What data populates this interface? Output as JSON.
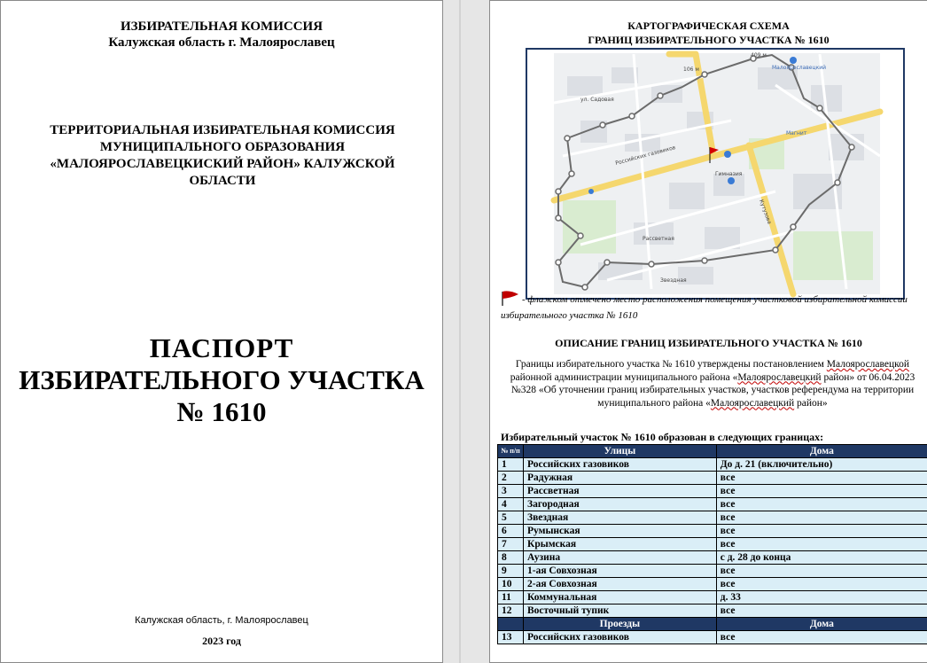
{
  "left_page": {
    "commission_line1": "ИЗБИРАТЕЛЬНАЯ КОМИССИЯ",
    "commission_line2": "Калужская область г. Малоярославец",
    "territorial_line1": "ТЕРРИТОРИАЛЬНАЯ ИЗБИРАТЕЛЬНАЯ КОМИССИЯ",
    "territorial_line2": "МУНИЦИПАЛЬНОГО ОБРАЗОВАНИЯ",
    "territorial_line3": "«МАЛОЯРОСЛАВЕЦКИСКИЙ РАЙОН» КАЛУЖСКОЙ",
    "territorial_line4": "ОБЛАСТИ",
    "passport_line1": "ПАСПОРТ",
    "passport_line2": "ИЗБИРАТЕЛЬНОГО УЧАСТКА",
    "passport_line3": "№ 1610",
    "footer_city": "Калужская область, г. Малоярославец",
    "footer_year": "2023 год"
  },
  "right_page": {
    "map_title_line1": "КАРТОГРАФИЧЕСКАЯ СХЕМА",
    "map_title_line2": "ГРАНИЦ ИЗБИРАТЕЛЬНОГО УЧАСТКА № 1610",
    "map_labels": {
      "dist1": "409 м",
      "dist2": "106 м",
      "poi1": "Малоярославецкий",
      "poi2": "Гимназия",
      "poi3": "Магнит",
      "street1": "ул. Садовая",
      "street2": "Российских газовиков",
      "street3": "Рассветная",
      "street4": "Звездная",
      "street5": "Кутузова"
    },
    "flag_note": "- флажком отмечено место расположения помещения участковой избирательной комиссии избирательного участка № 1610",
    "description_title": "ОПИСАНИЕ ГРАНИЦ ИЗБИРАТЕЛЬНОГО УЧАСТКА № 1610",
    "desc_part1": "Границы избирательного участка № 1610 утверждены постановлением ",
    "desc_word1": "Малоярославецкой",
    "desc_part2": " районной администрации муниципального района «",
    "desc_word2": "Малоярославецкий",
    "desc_part3": " район» от 06.04.2023 №328 «Об уточнении границ избирательных участков, участков референдума на территории муниципального района «",
    "desc_word3": "Малоярославецкий",
    "desc_part4": " район»",
    "table_intro": "Избирательный участок № 1610 образован в следующих границах:",
    "table_headers": {
      "num": "№ п/п",
      "streets": "Улицы",
      "houses": "Дома"
    },
    "rows": [
      {
        "n": "1",
        "street": "Российских газовиков",
        "houses": "До д. 21 (включительно)"
      },
      {
        "n": "2",
        "street": "Радужная",
        "houses": "все"
      },
      {
        "n": "3",
        "street": "Рассветная",
        "houses": "все"
      },
      {
        "n": "4",
        "street": "Загородная",
        "houses": "все"
      },
      {
        "n": "5",
        "street": "Звездная",
        "houses": "все"
      },
      {
        "n": "6",
        "street": "Румынская",
        "houses": "все"
      },
      {
        "n": "7",
        "street": "Крымская",
        "houses": "все"
      },
      {
        "n": "8",
        "street": "Аузина",
        "houses": " с д. 28 до конца"
      },
      {
        "n": "9",
        "street": "1-ая Совхозная",
        "houses": "все"
      },
      {
        "n": "10",
        "street": "2-ая Совхозная",
        "houses": "все"
      },
      {
        "n": "11",
        "street": "Коммунальная",
        "houses": "д. 33"
      },
      {
        "n": "12",
        "street": "Восточный тупик",
        "houses": "все"
      }
    ],
    "sub_headers": {
      "passages": "Проезды",
      "houses": "Дома"
    },
    "passage_rows": [
      {
        "n": "13",
        "street": "Российских газовиков",
        "houses": "все"
      }
    ]
  },
  "colors": {
    "table_header": "#1f3864",
    "table_cell": "#daeef7",
    "flag": "#c00000"
  }
}
